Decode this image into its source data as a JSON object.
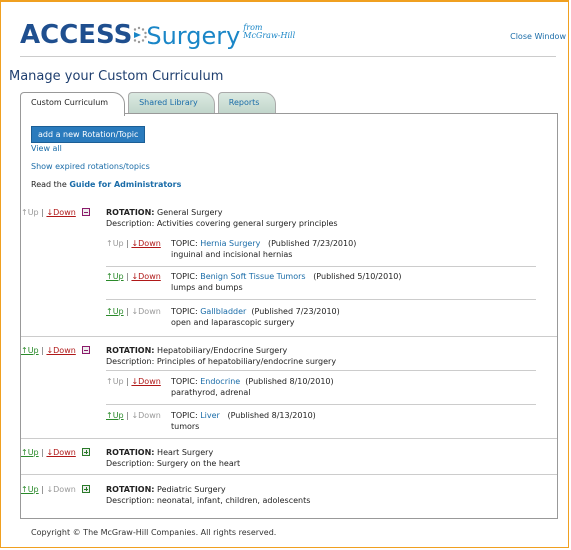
{
  "header": {
    "logo_access": "ACCESS",
    "logo_surgery": "Surgery",
    "logo_from": "from",
    "logo_publisher": "McGraw-Hill",
    "close_label": "Close Window"
  },
  "page_title": "Manage your Custom Curriculum",
  "tabs": [
    {
      "label": "Custom Curriculum",
      "active": true
    },
    {
      "label": "Shared Library",
      "active": false
    },
    {
      "label": "Reports",
      "active": false
    }
  ],
  "actions": {
    "add_label": "add a new Rotation/Topic",
    "view_all": "View all",
    "show_expired": "Show expired rotations/topics",
    "guide_prefix": "Read the",
    "guide_link": "Guide for Administrators"
  },
  "controls": {
    "up": "↑Up",
    "down": "↓Down",
    "sep": "|"
  },
  "labels": {
    "rotation": "ROTATION:",
    "description": "Description:",
    "topic": "TOPIC:"
  },
  "rotations": [
    {
      "name": "General Surgery",
      "description": "Activities covering general surgery principles",
      "topics": [
        {
          "name": "Hernia Surgery",
          "published": "(Published 7/23/2010)",
          "detail": "inguinal and incisional hernias"
        },
        {
          "name": "Benign Soft Tissue Tumors",
          "published": "(Published 5/10/2010)",
          "detail": "lumps and bumps"
        },
        {
          "name": "Gallbladder",
          "published": "(Published 7/23/2010)",
          "detail": "open and laparascopic surgery"
        }
      ]
    },
    {
      "name": "Hepatobiliary/Endocrine Surgery",
      "description": "Principles of hepatobiliary/endocrine surgery",
      "topics": [
        {
          "name": "Endocrine",
          "published": "(Published 8/10/2010)",
          "detail": "parathyrod, adrenal"
        },
        {
          "name": "Liver",
          "published": "(Published 8/13/2010)",
          "detail": "tumors"
        }
      ]
    },
    {
      "name": "Heart Surgery",
      "description": "Surgery on the heart",
      "topics": []
    },
    {
      "name": "Pediatric Surgery",
      "description": "neonatal, infant, children, adolescents",
      "topics": []
    }
  ],
  "footer": "Copyright © The McGraw-Hill Companies. All rights reserved."
}
